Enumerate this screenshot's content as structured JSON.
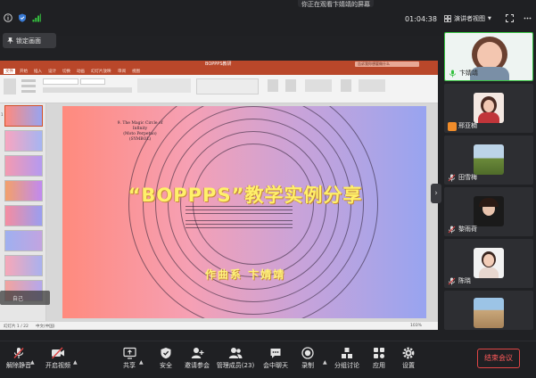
{
  "topbar": {
    "notice": "你正在观看卞婧靖的屏幕",
    "timer": "01:04:38",
    "view_label": "演讲者视图",
    "lock_label": "锁定画面"
  },
  "ppt": {
    "filename": "BOPPPS教研",
    "search_placeholder": "告诉我你想要做什么",
    "tabs": [
      "文件",
      "开始",
      "插入",
      "设计",
      "切换",
      "动画",
      "幻灯片放映",
      "审阅",
      "视图"
    ],
    "statusbar_left": "幻灯片 1 / 22",
    "statusbar_lang": "中文(中国)",
    "zoom": "103%"
  },
  "slide": {
    "score_text": "9. The Magic Circle of Infinity\n(Moto Perpetuo)\n(SYMBOL)",
    "title": "“BOPPPS”教学实例分享",
    "subtitle": "作曲系 卞婧靖"
  },
  "float_self": "自己",
  "participants": [
    {
      "name": "卞婧靖",
      "active": true,
      "mic": "green",
      "bg": "#e9f0ee"
    },
    {
      "name": "邢亚楠",
      "active": false,
      "mic": "orange",
      "bg": "#2d2e32"
    },
    {
      "name": "田雪梅",
      "active": false,
      "mic": "muted",
      "bg": "#2d2e32"
    },
    {
      "name": "黎雨荷",
      "active": false,
      "mic": "muted",
      "bg": "#2d2e32"
    },
    {
      "name": "陈晓",
      "active": false,
      "mic": "muted",
      "bg": "#2d2e32"
    },
    {
      "name": "",
      "active": false,
      "mic": "none",
      "bg": "#2d2e32"
    }
  ],
  "toolbar": {
    "mute": "解除静音",
    "video": "开启视频",
    "share": "共享",
    "security": "安全",
    "invite": "邀请参会",
    "members": "管理成员(23)",
    "chat": "会中聊天",
    "record": "录制",
    "breakout": "分组讨论",
    "apps": "应用",
    "settings": "设置",
    "end": "结束会议"
  },
  "colors": {
    "accent_green": "#35c13f",
    "end_red": "#e04545",
    "ppt_brand": "#b9472a",
    "title_yellow": "#fff06a"
  }
}
